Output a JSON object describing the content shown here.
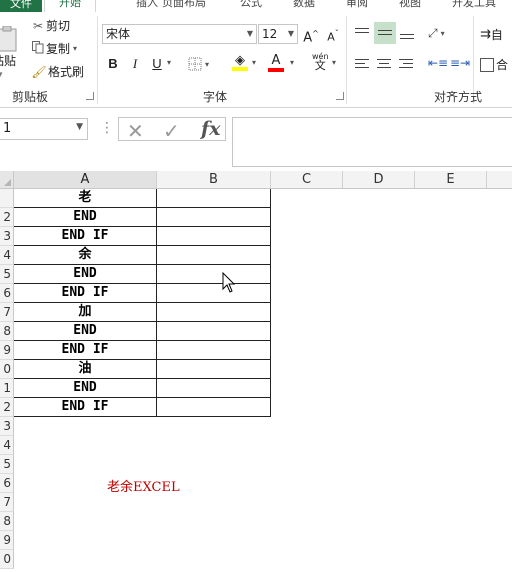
{
  "tabs": {
    "file": "文件",
    "home": "开始",
    "insert": "插入",
    "layout": "页面布局",
    "formulas": "公式",
    "data": "数据",
    "review": "审阅",
    "view": "视图",
    "developer": "开发工具"
  },
  "clipboard": {
    "paste": "粘贴",
    "cut": "剪切",
    "copy": "复制",
    "format_painter": "格式刷",
    "group_label": "剪贴板"
  },
  "font": {
    "name": "宋体",
    "size": "12",
    "bold": "B",
    "italic": "I",
    "underline": "U",
    "font_color_letter": "A",
    "phonetic": "wén",
    "phonetic_char": "文",
    "group_label": "字体",
    "grow": "A",
    "shrink": "A"
  },
  "alignment": {
    "group_label": "对齐方式",
    "wrap_short": "自",
    "merge_short": "合"
  },
  "formula_bar": {
    "name_box": "1",
    "cancel": "✕",
    "enter": "✓",
    "fx": "fx",
    "content": ""
  },
  "columns": [
    "A",
    "B",
    "C",
    "D",
    "E"
  ],
  "row_numbers": [
    "",
    "2",
    "3",
    "4",
    "5",
    "6",
    "7",
    "8",
    "9",
    "0",
    "1",
    "2",
    "3",
    "4",
    "5",
    "6",
    "7",
    "8",
    "9",
    "0"
  ],
  "cells": [
    "老",
    "END",
    "END IF",
    "余",
    "END",
    "END IF",
    "加",
    "END",
    "END IF",
    "油",
    "END",
    "END IF"
  ],
  "watermark": "老余EXCEL",
  "colors": {
    "excel_green": "#217346",
    "watermark_red": "#c00000",
    "highlight_yellow": "#ffff00",
    "font_red": "#ff0000"
  }
}
